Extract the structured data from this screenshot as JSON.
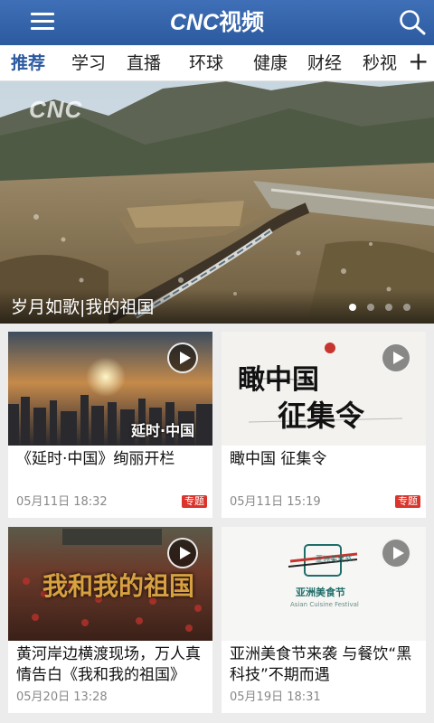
{
  "header": {
    "logo_latin": "CNC",
    "logo_cn": "视频",
    "menu_icon": "hamburger-icon",
    "search_icon": "search-icon",
    "brand_color": "#2c5aa0"
  },
  "tabs": [
    {
      "label": "推荐",
      "active": true
    },
    {
      "label": "学习"
    },
    {
      "label": "直播"
    },
    {
      "label": "环球"
    },
    {
      "label": "健康"
    },
    {
      "label": "财经"
    },
    {
      "label": "秒视"
    }
  ],
  "tab_add_label": "+",
  "banner": {
    "watermark": "CNC",
    "caption": "岁月如歌|我的祖国",
    "slide_count": 4,
    "active_slide": 1
  },
  "cards": [
    {
      "title": "《延时·中国》绚丽开栏",
      "time": "05月11日 18:32",
      "badge": "专题",
      "thumb_text": "延时·中国",
      "play_icon": "play-icon"
    },
    {
      "title": "瞰中国 征集令",
      "time": "05月11日 15:19",
      "badge": "专题",
      "thumb_text_1": "瞰中国",
      "thumb_text_2": "征集令",
      "play_icon": "play-icon"
    },
    {
      "title": "黄河岸边横渡现场，万人真情告白《我和我的祖国》",
      "time": "05月20日 13:28",
      "thumb_text": "我和我的祖国",
      "play_icon": "play-icon"
    },
    {
      "title": "亚洲美食节来袭 与餐饮“黑科技”不期而遇",
      "time": "05月19日 18:31",
      "thumb_text": "亚洲美食节",
      "thumb_subtext": "Asian Cuisine Festival",
      "thumb_seal": "亚洲美食节",
      "play_icon": "play-icon"
    }
  ]
}
